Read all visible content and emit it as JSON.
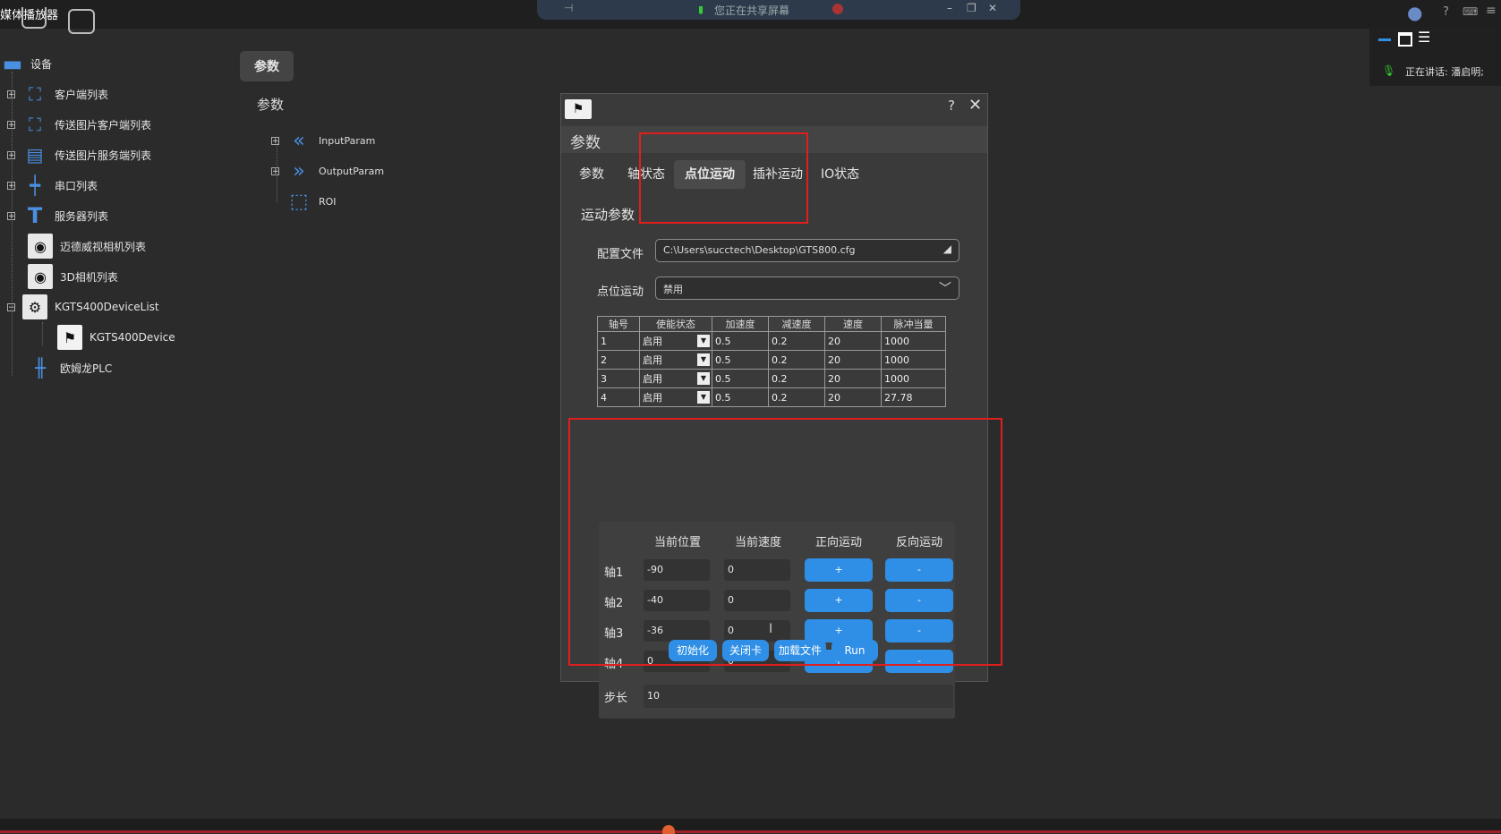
{
  "app": {
    "title": "媒体播放器"
  },
  "share_bar": {
    "text": "您正在共享屏幕"
  },
  "meeting": {
    "speaking": "正在讲话: 潘启明;"
  },
  "tree": {
    "root": "设备",
    "items": [
      "客户端列表",
      "传送图片客户端列表",
      "传送图片服务端列表",
      "串口列表",
      "服务器列表",
      "迈德威视相机列表",
      "3D相机列表",
      "KGTS400DeviceList",
      "KGTS400Device",
      "欧姆龙PLC"
    ]
  },
  "middle": {
    "button": "参数",
    "label": "参数",
    "items": [
      "InputParam",
      "OutputParam",
      "ROI"
    ]
  },
  "dialog": {
    "help": "?",
    "close": "✕",
    "header": "参数",
    "tabs": [
      "参数",
      "轴状态",
      "点位运动",
      "插补运动",
      "IO状态"
    ],
    "section": "运动参数",
    "config_label": "配置文件",
    "config_value": "C:\\Users\\succtech\\Desktop\\GTS800.cfg",
    "point_label": "点位运动",
    "point_value": "禁用",
    "table": {
      "headers": [
        "轴号",
        "使能状态",
        "加速度",
        "减速度",
        "速度",
        "脉冲当量"
      ],
      "rows": [
        [
          "1",
          "启用",
          "0.5",
          "0.2",
          "20",
          "1000"
        ],
        [
          "2",
          "启用",
          "0.5",
          "0.2",
          "20",
          "1000"
        ],
        [
          "3",
          "启用",
          "0.5",
          "0.2",
          "20",
          "1000"
        ],
        [
          "4",
          "启用",
          "0.5",
          "0.2",
          "20",
          "27.78"
        ]
      ]
    },
    "motion": {
      "col_headers": [
        "当前位置",
        "当前速度",
        "正向运动",
        "反向运动"
      ],
      "axes": [
        {
          "label": "轴1",
          "position": "-90",
          "speed": "0"
        },
        {
          "label": "轴2",
          "position": "-40",
          "speed": "0"
        },
        {
          "label": "轴3",
          "position": "-36",
          "speed": "0"
        },
        {
          "label": "轴4",
          "position": "0",
          "speed": "0"
        }
      ],
      "plus": "+",
      "minus": "-",
      "step_label": "步长",
      "step_value": "10"
    },
    "actions": [
      "初始化",
      "关闭卡",
      "加载文件",
      "Run"
    ]
  },
  "colors": {
    "accent": "#2f8fe6",
    "highlight": "#e01e1e",
    "background": "#2b2b2b"
  }
}
